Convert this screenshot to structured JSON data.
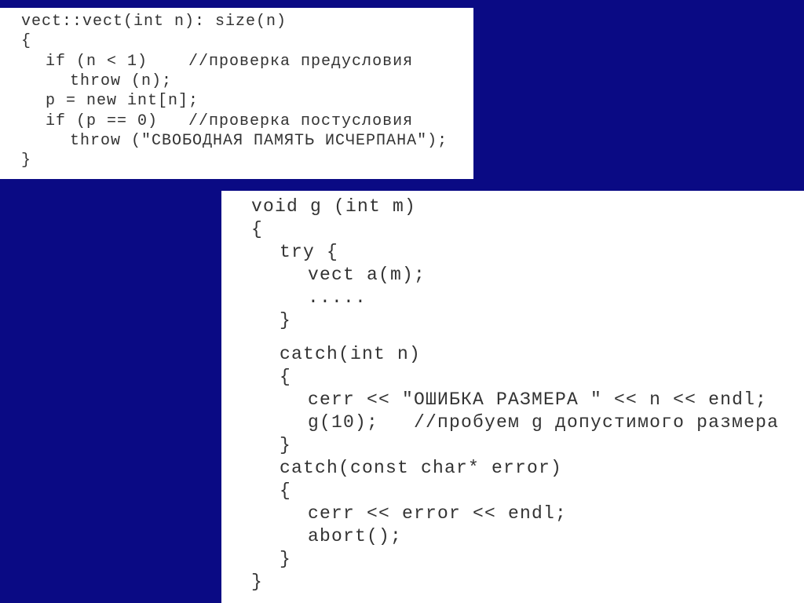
{
  "slide": {
    "background_color": "#0a0a84",
    "top_code": [
      {
        "indent": 0,
        "text": "vect::vect(int n): size(n)"
      },
      {
        "indent": 0,
        "text": "{"
      },
      {
        "indent": 1,
        "text": "if (n < 1)    //проверка предусловия"
      },
      {
        "indent": 2,
        "text": "throw (n);"
      },
      {
        "indent": 1,
        "text": "p = new int[n];"
      },
      {
        "indent": 1,
        "text": "if (p == 0)   //проверка постусловия"
      },
      {
        "indent": 2,
        "text": "throw (\"СВОБОДНАЯ ПАМЯТЬ ИСЧЕРПАНА\");"
      },
      {
        "indent": 0,
        "text": "}"
      }
    ],
    "bottom_code": [
      {
        "indent": 0,
        "text": "void g (int m)"
      },
      {
        "indent": 0,
        "text": "{"
      },
      {
        "indent": 1,
        "text": "try {"
      },
      {
        "indent": 2,
        "text": "vect a(m);"
      },
      {
        "indent": 2,
        "text": "....."
      },
      {
        "indent": 1,
        "text": "}"
      },
      {
        "indent": 1,
        "text": "catch(int n)"
      },
      {
        "indent": 1,
        "text": "{"
      },
      {
        "indent": 2,
        "text": "cerr << \"ОШИБКА РАЗМЕРА \" << n << endl;"
      },
      {
        "indent": 2,
        "text": "g(10);   //пробуем g допустимого размера"
      },
      {
        "indent": 1,
        "text": "}"
      },
      {
        "indent": 1,
        "text": "catch(const char* error)"
      },
      {
        "indent": 1,
        "text": "{"
      },
      {
        "indent": 2,
        "text": "cerr << error << endl;"
      },
      {
        "indent": 2,
        "text": "abort();"
      },
      {
        "indent": 1,
        "text": "}"
      },
      {
        "indent": 0,
        "text": "}"
      }
    ]
  }
}
